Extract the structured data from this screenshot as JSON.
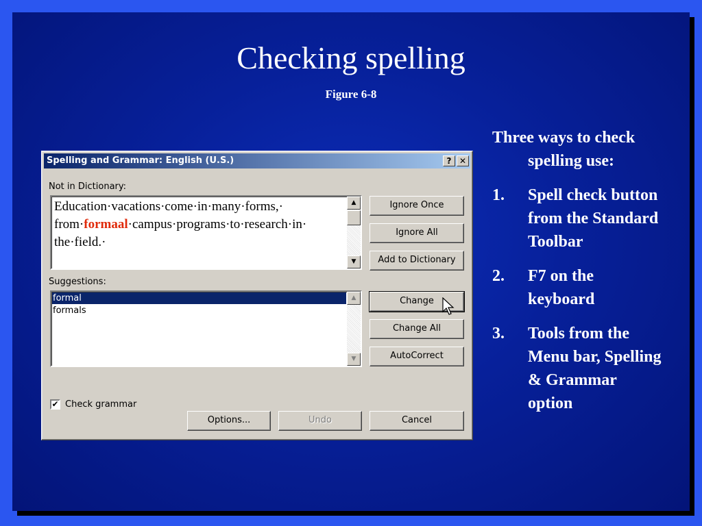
{
  "slide": {
    "title": "Checking spelling",
    "subtitle": "Figure 6-8",
    "notes": {
      "intro": "Three ways to check spelling use:",
      "items": [
        {
          "num": "1.",
          "text": "Spell check button from the Standard Toolbar"
        },
        {
          "num": "2.",
          "text": "F7 on the keyboard"
        },
        {
          "num": "3.",
          "text": "Tools from the Menu bar, Spelling & Grammar option"
        }
      ]
    }
  },
  "dialog": {
    "title": "Spelling and Grammar: English (U.S.)",
    "help_glyph": "?",
    "close_glyph": "✕",
    "not_in_dictionary_label": "Not in Dictionary:",
    "text_before": "Education·vacations·come·in·many·forms,· from·",
    "misspelled_word": "formaal",
    "text_after": "·campus·programs·to·research·in· the·field.·",
    "suggestions_label": "Suggestions:",
    "suggestions": [
      "formal",
      "formals"
    ],
    "buttons": {
      "ignore_once": "Ignore Once",
      "ignore_all": "Ignore All",
      "add_to_dictionary": "Add to Dictionary",
      "change": "Change",
      "change_all": "Change All",
      "autocorrect": "AutoCorrect",
      "options": "Options...",
      "undo": "Undo",
      "cancel": "Cancel"
    },
    "check_grammar": {
      "label": "Check grammar",
      "checked": true,
      "check_glyph": "✔"
    },
    "scroll_up_glyph": "▲",
    "scroll_down_glyph": "▼"
  }
}
